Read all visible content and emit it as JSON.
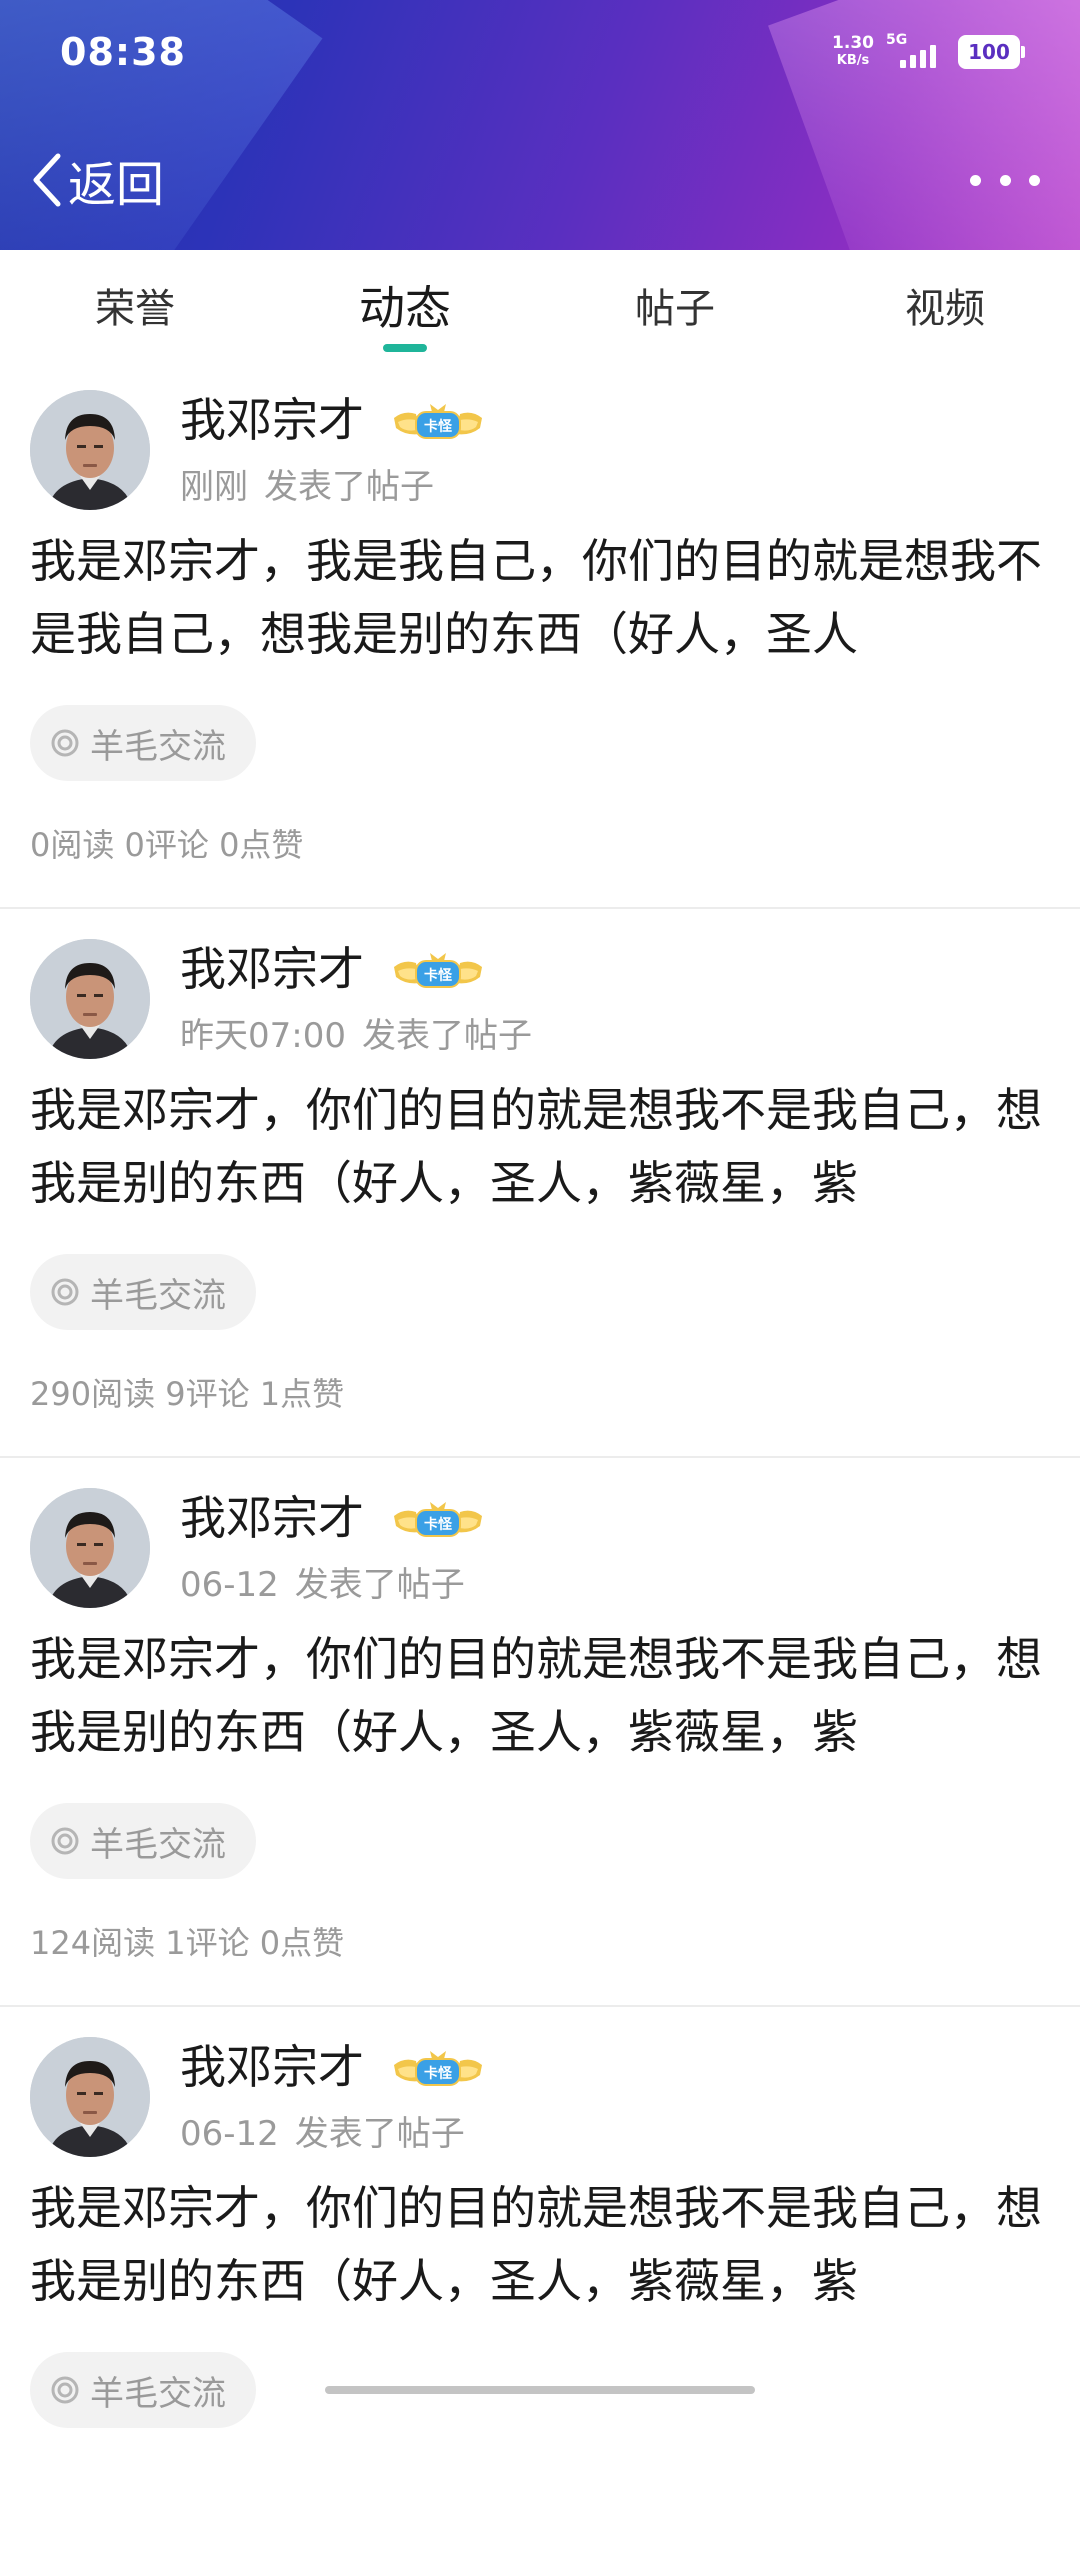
{
  "status_bar": {
    "time": "08:38",
    "net_speed_value": "1.30",
    "net_speed_unit": "KB/s",
    "network": "5G",
    "battery": "100"
  },
  "nav": {
    "back_label": "返回",
    "back_icon": "chevron-left-icon",
    "more_icon": "more-horizontal-icon"
  },
  "tabs": [
    {
      "label": "荣誉",
      "active": false
    },
    {
      "label": "动态",
      "active": true
    },
    {
      "label": "帖子",
      "active": false
    },
    {
      "label": "视频",
      "active": false
    }
  ],
  "colors": {
    "accent": "#1fb59a",
    "header_start": "#1f2fa6",
    "header_end": "#b040c8",
    "muted_text": "#9a9a9a"
  },
  "posts": [
    {
      "author": "我邓宗才",
      "badge": "卡怪",
      "time": "刚刚",
      "action": "发表了帖子",
      "text": "我是邓宗才，我是我自己，你们的目的就是想我不是我自己，想我是别的东西（好人，圣人",
      "tag": "羊毛交流",
      "stats": "0阅读 0评论 0点赞"
    },
    {
      "author": "我邓宗才",
      "badge": "卡怪",
      "time": "昨天07:00",
      "action": "发表了帖子",
      "text": "我是邓宗才，你们的目的就是想我不是我自己，想我是别的东西（好人，圣人，紫薇星，紫",
      "tag": "羊毛交流",
      "stats": "290阅读 9评论 1点赞"
    },
    {
      "author": "我邓宗才",
      "badge": "卡怪",
      "time": "06-12",
      "action": "发表了帖子",
      "text": "我是邓宗才，你们的目的就是想我不是我自己，想我是别的东西（好人，圣人，紫薇星，紫",
      "tag": "羊毛交流",
      "stats": "124阅读 1评论 0点赞"
    },
    {
      "author": "我邓宗才",
      "badge": "卡怪",
      "time": "06-12",
      "action": "发表了帖子",
      "text": "我是邓宗才，你们的目的就是想我不是我自己，想我是别的东西（好人，圣人，紫薇星，紫",
      "tag": "羊毛交流",
      "stats": ""
    }
  ]
}
